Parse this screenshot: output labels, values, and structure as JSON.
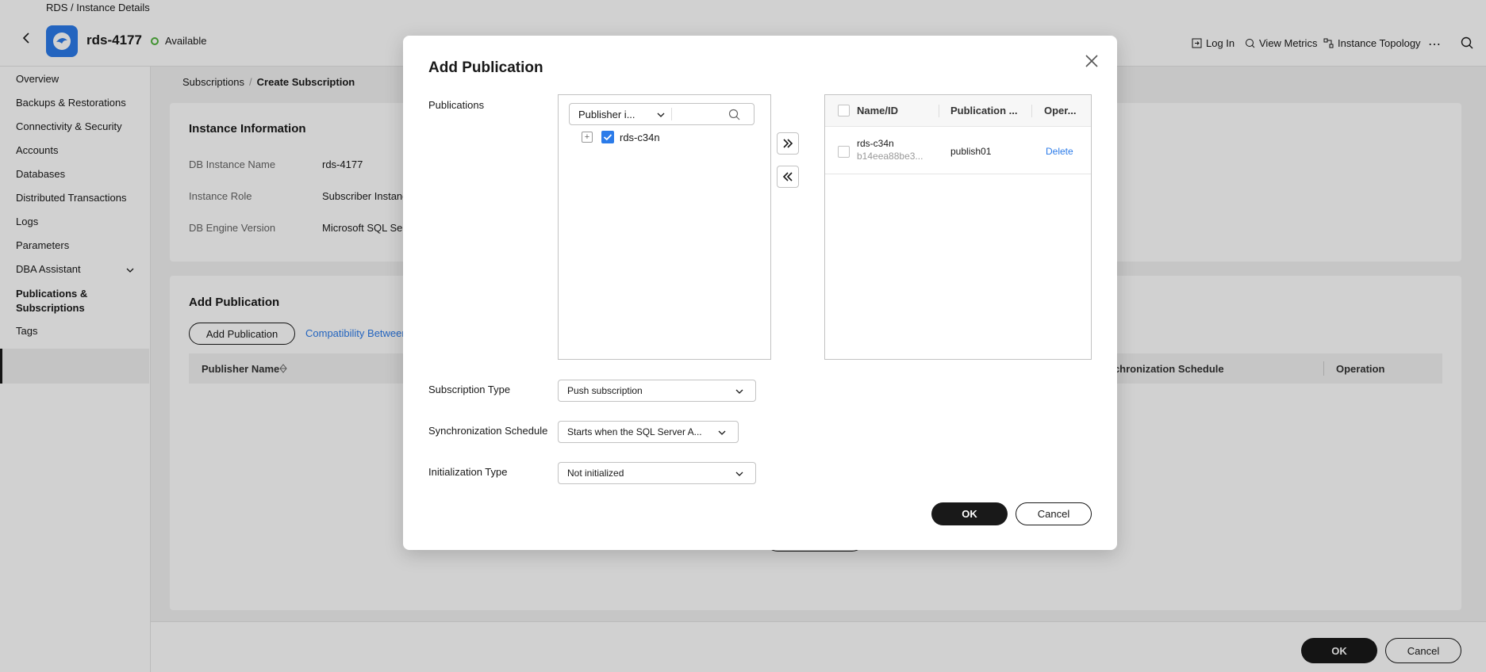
{
  "header": {
    "breadcrumb": "RDS / Instance Details",
    "instance_name": "rds-4177",
    "status": "Available",
    "actions": [
      {
        "label": "Log In",
        "icon": "login-icon"
      },
      {
        "label": "View Metrics",
        "icon": "metrics-icon"
      },
      {
        "label": "Instance Topology",
        "icon": "topology-icon"
      }
    ],
    "more": "⋯"
  },
  "sidebar": {
    "items": [
      {
        "label": "Overview"
      },
      {
        "label": "Backups & Restorations"
      },
      {
        "label": "Connectivity & Security"
      },
      {
        "label": "Accounts"
      },
      {
        "label": "Databases"
      },
      {
        "label": "Distributed Transactions"
      },
      {
        "label": "Logs"
      },
      {
        "label": "Parameters"
      },
      {
        "label": "DBA Assistant"
      },
      {
        "label": "Publications & Subscriptions"
      },
      {
        "label": "Tags"
      }
    ]
  },
  "content": {
    "breadcrumb": {
      "parent": "Subscriptions",
      "separator": "/",
      "current": "Create Subscription"
    },
    "instance_info": {
      "title": "Instance Information",
      "rows": [
        {
          "label": "DB Instance Name",
          "value": "rds-4177"
        },
        {
          "label": "Instance Role",
          "value": "Subscriber Instance"
        },
        {
          "label": "DB Engine Version",
          "value": "Microsoft SQL Serv"
        }
      ]
    },
    "add_publication": {
      "title": "Add Publication",
      "button": "Add Publication",
      "link": "Compatibility Between",
      "columns": [
        "Publisher Name",
        "nchronization Schedule",
        "Operation"
      ]
    }
  },
  "footer": {
    "ok": "OK",
    "cancel": "Cancel"
  },
  "modal": {
    "title": "Add Publication",
    "publications_label": "Publications",
    "filter": {
      "selected": "Publisher i...",
      "search_placeholder": ""
    },
    "tree": [
      {
        "label": "rds-c34n",
        "checked": true,
        "expand": "+"
      }
    ],
    "right_table": {
      "columns": [
        "Name/ID",
        "Publication ...",
        "Oper..."
      ],
      "rows": [
        {
          "name": "rds-c34n",
          "id": "b14eea88be3...",
          "publication": "publish01",
          "operation": "Delete"
        }
      ]
    },
    "subscription_type": {
      "label": "Subscription Type",
      "value": "Push subscription"
    },
    "sync_schedule": {
      "label": "Synchronization Schedule",
      "value": "Starts when the SQL Server A..."
    },
    "init_type": {
      "label": "Initialization Type",
      "value": "Not initialized"
    },
    "ok": "OK",
    "cancel": "Cancel"
  },
  "colors": {
    "accent": "#2b7be9",
    "status_ok": "#50b43c",
    "dark": "#191919"
  }
}
